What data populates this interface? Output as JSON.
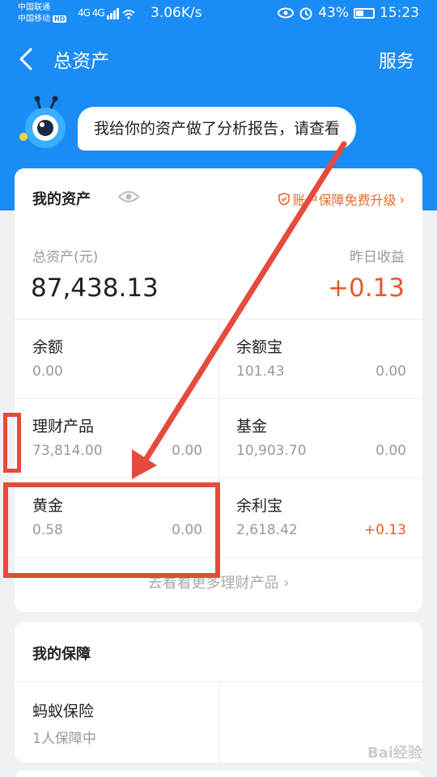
{
  "status": {
    "carrier1": "中国联通",
    "carrier2": "中国移动",
    "hd": "HD",
    "signal_text": "4G 4G",
    "net_speed": "3.06K/s",
    "battery": "43%",
    "time": "15:23",
    "battery_level": 0.43
  },
  "header": {
    "title": "总资产",
    "service": "服务"
  },
  "bubble": {
    "text": "我给你的资产做了分析报告，请查看"
  },
  "assets": {
    "title": "我的资产",
    "upgrade": "账户保障免费升级",
    "total_label": "总资产(元)",
    "total_value": "87,438.13",
    "yesterday_label": "昨日收益",
    "yesterday_value": "+0.13",
    "items": [
      {
        "title": "余额",
        "amount": "0.00",
        "earn": ""
      },
      {
        "title": "余额宝",
        "amount": "101.43",
        "earn": "0.00"
      },
      {
        "title": "理财产品",
        "amount": "73,814.00",
        "earn": "0.00"
      },
      {
        "title": "基金",
        "amount": "10,903.70",
        "earn": "0.00"
      },
      {
        "title": "黄金",
        "amount": "0.58",
        "earn": "0.00"
      },
      {
        "title": "余利宝",
        "amount": "2,618.42",
        "earn": "+0.13"
      }
    ],
    "more": "去看看更多理财产品"
  },
  "protection": {
    "title": "我的保障",
    "item_title": "蚂蚁保险",
    "item_sub": "1人保障中"
  },
  "watermark": "Bai经验",
  "colors": {
    "brand_blue": "#1a8cf5",
    "accent_orange": "#e8592c",
    "annotation_red": "#e54b3c"
  }
}
